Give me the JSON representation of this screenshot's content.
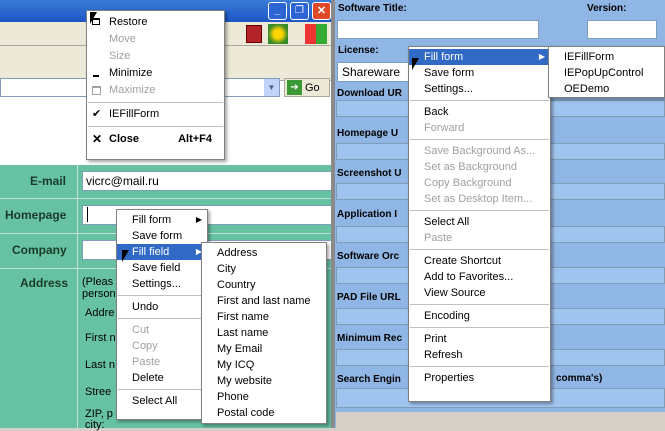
{
  "left_window": {
    "title_buttons": [
      "_",
      "❐",
      "✕"
    ],
    "address_go": "Go",
    "form": {
      "email_label": "E-mail",
      "email_value": "vicrc@mail.ru",
      "homepage_label": "Homepage",
      "company_label": "Company",
      "address_label": "Address",
      "address_hint": "(Pleas",
      "address_hint2": "person",
      "sub_labels": [
        "Addre",
        "First n",
        "Last n",
        "Stree",
        "ZIP, p",
        "city:"
      ]
    }
  },
  "system_menu": {
    "items": [
      {
        "label": "Restore",
        "icon": "restore-icon",
        "disabled": false
      },
      {
        "label": "Move",
        "disabled": true
      },
      {
        "label": "Size",
        "disabled": true
      },
      {
        "label": "Minimize",
        "icon": "minimize-icon",
        "disabled": false
      },
      {
        "label": "Maximize",
        "icon": "maximize-icon",
        "disabled": true
      },
      {
        "label": "IEFillForm",
        "icon": "check-icon",
        "disabled": false
      },
      {
        "label": "Close",
        "shortcut": "Alt+F4",
        "icon": "close-icon",
        "disabled": false
      }
    ]
  },
  "left_context_menu": {
    "items": [
      "Fill form",
      "Save form",
      "Fill field",
      "Save field",
      "Settings...",
      "Undo",
      "Cut",
      "Copy",
      "Paste",
      "Delete",
      "Select All"
    ]
  },
  "fill_field_submenu": {
    "items": [
      "Address",
      "City",
      "Country",
      "First and last name",
      "First name",
      "Last name",
      "My Email",
      "My ICQ",
      "My website",
      "Phone",
      "Postal code"
    ]
  },
  "right_window": {
    "software_title_label": "Software Title:",
    "version_label": "Version:",
    "license_label": "License:",
    "license_value": "Shareware",
    "field_labels": [
      "Download UR",
      "Homepage U",
      "Screenshot U",
      "Application I",
      "Software Orc",
      "PAD File URL",
      "Minimum Rec",
      "Search Engin"
    ],
    "search_suffix": "comma's)"
  },
  "ie_context_menu": {
    "items": [
      "Fill form",
      "Save form",
      "Settings...",
      "Back",
      "Forward",
      "Save Background As...",
      "Set as Background",
      "Copy Background",
      "Set as Desktop Item...",
      "Select All",
      "Paste",
      "Create Shortcut",
      "Add to Favorites...",
      "View Source",
      "Encoding",
      "Print",
      "Refresh",
      "Properties"
    ]
  },
  "fill_form_submenu": {
    "items": [
      "IEFillForm",
      "IEPopUpControl",
      "OEDemo"
    ]
  },
  "colors": {
    "highlight": "#316ac5",
    "form_green": "#66c2a3",
    "field_blue": "#9fc5ef"
  }
}
